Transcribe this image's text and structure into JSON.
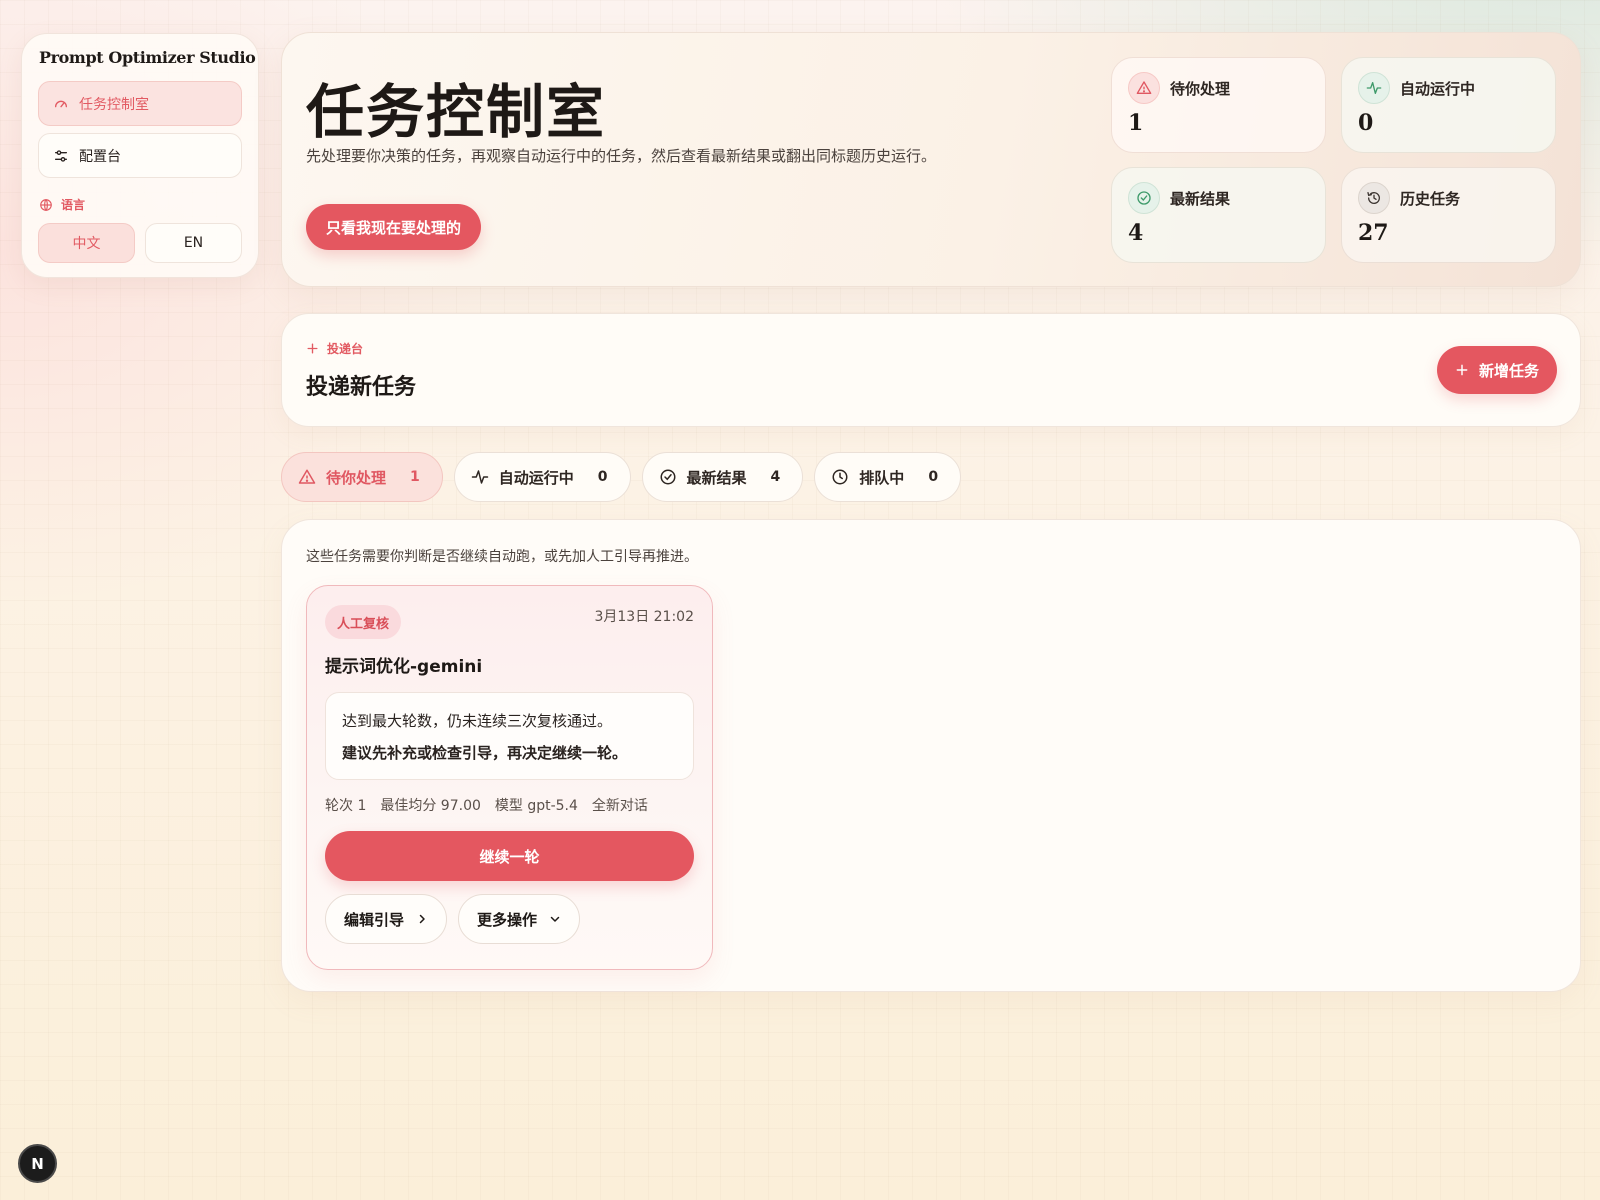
{
  "sidebar": {
    "brand": "Prompt Optimizer Studio",
    "items": [
      {
        "label": "任务控制室",
        "icon": "gauge-icon",
        "active": true
      },
      {
        "label": "配置台",
        "icon": "sliders-icon",
        "active": false
      }
    ],
    "language_label": "语言",
    "languages": [
      {
        "label": "中文",
        "active": true
      },
      {
        "label": "EN",
        "active": false
      }
    ]
  },
  "hero": {
    "title": "任务控制室",
    "description": "先处理要你决策的任务，再观察自动运行中的任务，然后查看最新结果或翻出同标题历史运行。",
    "cta": "只看我现在要处理的",
    "stats": [
      {
        "label": "待你处理",
        "value": "1",
        "icon": "alert-triangle-icon",
        "tone": "red"
      },
      {
        "label": "自动运行中",
        "value": "0",
        "icon": "activity-icon",
        "tone": "green"
      },
      {
        "label": "最新结果",
        "value": "4",
        "icon": "check-circle-icon",
        "tone": "green"
      },
      {
        "label": "历史任务",
        "value": "27",
        "icon": "history-icon",
        "tone": "gray"
      }
    ]
  },
  "dispatch": {
    "label": "投递台",
    "title": "投递新任务",
    "button": "新增任务"
  },
  "tabs": [
    {
      "label": "待你处理",
      "count": "1",
      "icon": "alert-triangle-icon",
      "active": true
    },
    {
      "label": "自动运行中",
      "count": "0",
      "icon": "activity-icon",
      "active": false
    },
    {
      "label": "最新结果",
      "count": "4",
      "icon": "check-circle-icon",
      "active": false
    },
    {
      "label": "排队中",
      "count": "0",
      "icon": "clock-icon",
      "active": false
    }
  ],
  "panel": {
    "description": "这些任务需要你判断是否继续自动跑，或先加人工引导再推进。",
    "card": {
      "badge": "人工复核",
      "time": "3月13日 21:02",
      "title": "提示词优化-gemini",
      "note_line1": "达到最大轮数，仍未连续三次复核通过。",
      "note_line2": "建议先补充或检查引导，再决定继续一轮。",
      "meta": [
        "轮次 1",
        "最佳均分 97.00",
        "模型 gpt-5.4",
        "全新对话"
      ],
      "primary": "继续一轮",
      "edit": "编辑引导",
      "more": "更多操作"
    }
  },
  "dev_badge": "N",
  "colors": {
    "accent": "#e45760",
    "accent_soft": "#fbe1dc",
    "success": "#3e9a6a"
  }
}
